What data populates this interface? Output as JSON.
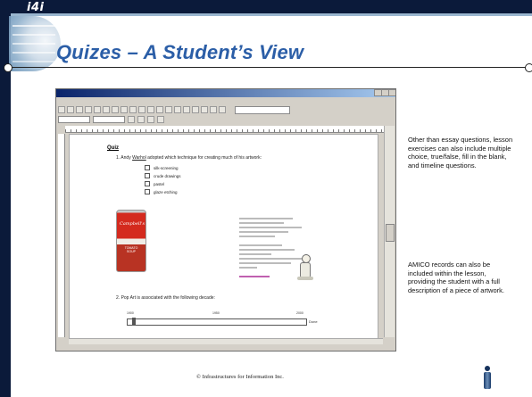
{
  "slide": {
    "brand": "i4i",
    "title": "Quizes – A Student’s View",
    "footer": "© Infrastructures for Information Inc.",
    "notes": [
      "Other than essay questions, lesson exercises can also include multiple choice, true/false, fill in the blank, and timeline  questions.",
      "AMICO records can also be included within the lesson, providing the student with a full description of a piece of artwork."
    ]
  },
  "document": {
    "heading": "Quiz",
    "question1": {
      "number": "1.",
      "pre": "Andy ",
      "highlight": "Warhol",
      "post": " adopted which technique for creating much of his artwork:"
    },
    "options": [
      "silk-screening",
      "crude drawings",
      "pastel",
      "glaze etching"
    ],
    "can": {
      "brand": "Campbell's",
      "label": "TOMATO SOUP"
    },
    "question2": {
      "number": "2.",
      "text": "Pop Art is associated with the following decade:"
    },
    "timeline": {
      "labels": [
        "1900",
        "1950",
        "2000"
      ],
      "done": "Done"
    }
  },
  "colors": {
    "title": "#2b5ea7",
    "chrome": "#0b1a3a",
    "link": "#a0208a"
  }
}
